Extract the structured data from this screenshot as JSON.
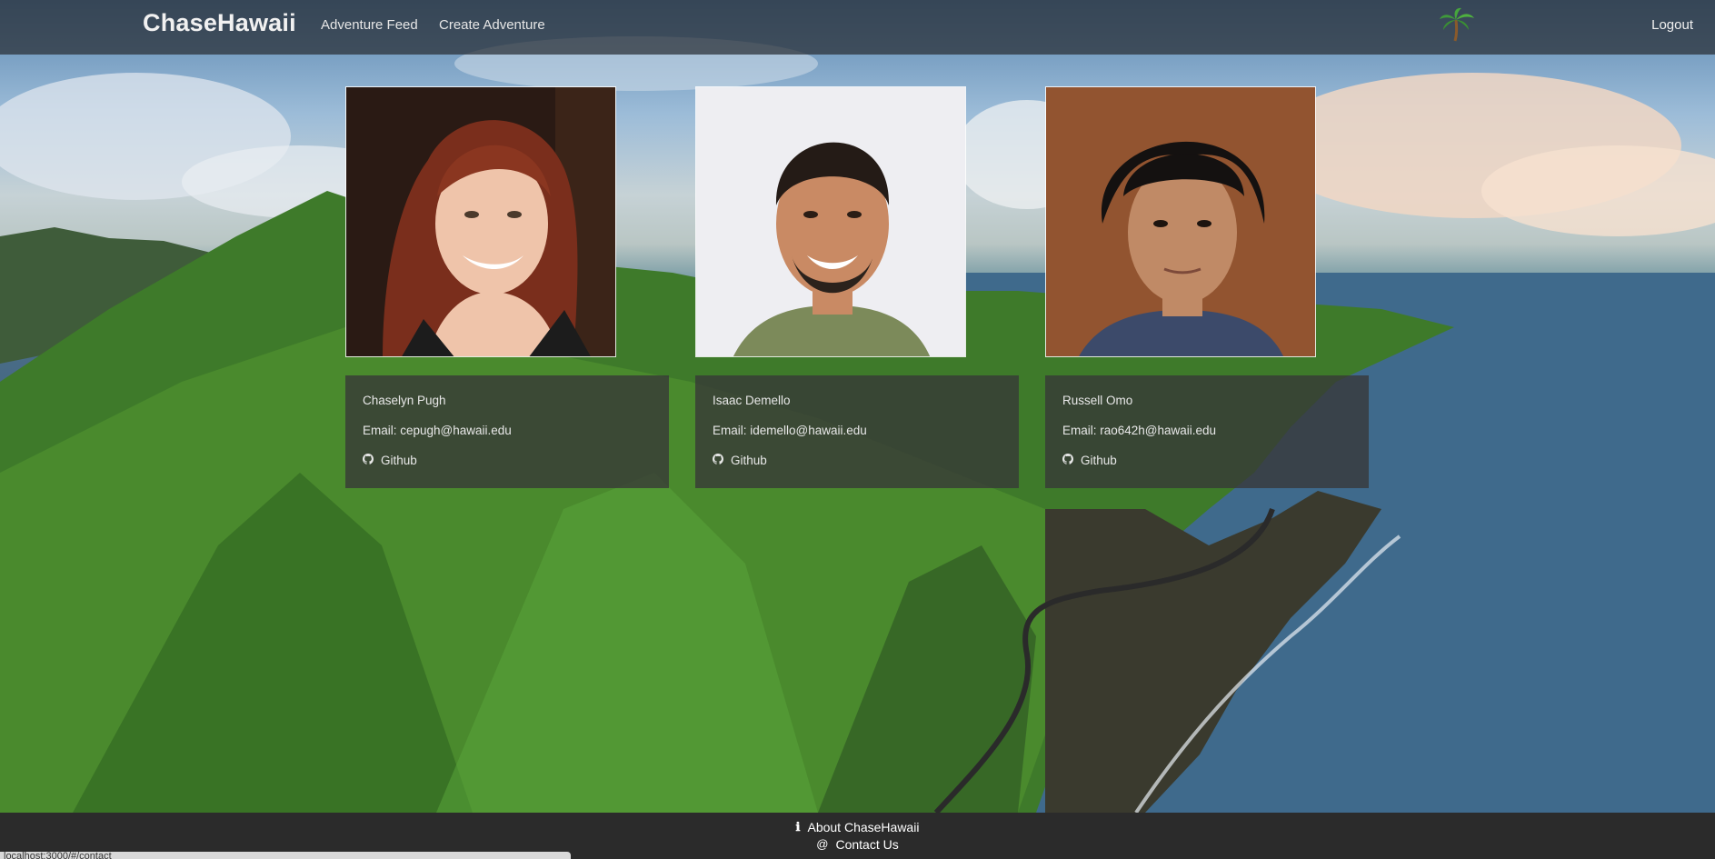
{
  "navbar": {
    "brand": "ChaseHawaii",
    "links": [
      "Adventure Feed",
      "Create Adventure"
    ],
    "logo_icon": "palm-tree-icon",
    "logout": "Logout"
  },
  "team": [
    {
      "name": "Chaselyn Pugh",
      "email": "Email: cepugh@hawaii.edu",
      "github": "Github"
    },
    {
      "name": "Isaac Demello",
      "email": "Email: idemello@hawaii.edu",
      "github": "Github"
    },
    {
      "name": "Russell Omo",
      "email": "Email: rao642h@hawaii.edu",
      "github": "Github"
    }
  ],
  "footer": {
    "about": "About ChaseHawaii",
    "contact": "Contact Us"
  },
  "status_bar": {
    "url": "localhost:3000/#/contact"
  },
  "colors": {
    "navbar_bg": "#282e34",
    "card_info_bg": "#373737",
    "footer_bg": "#2b2b2b"
  }
}
